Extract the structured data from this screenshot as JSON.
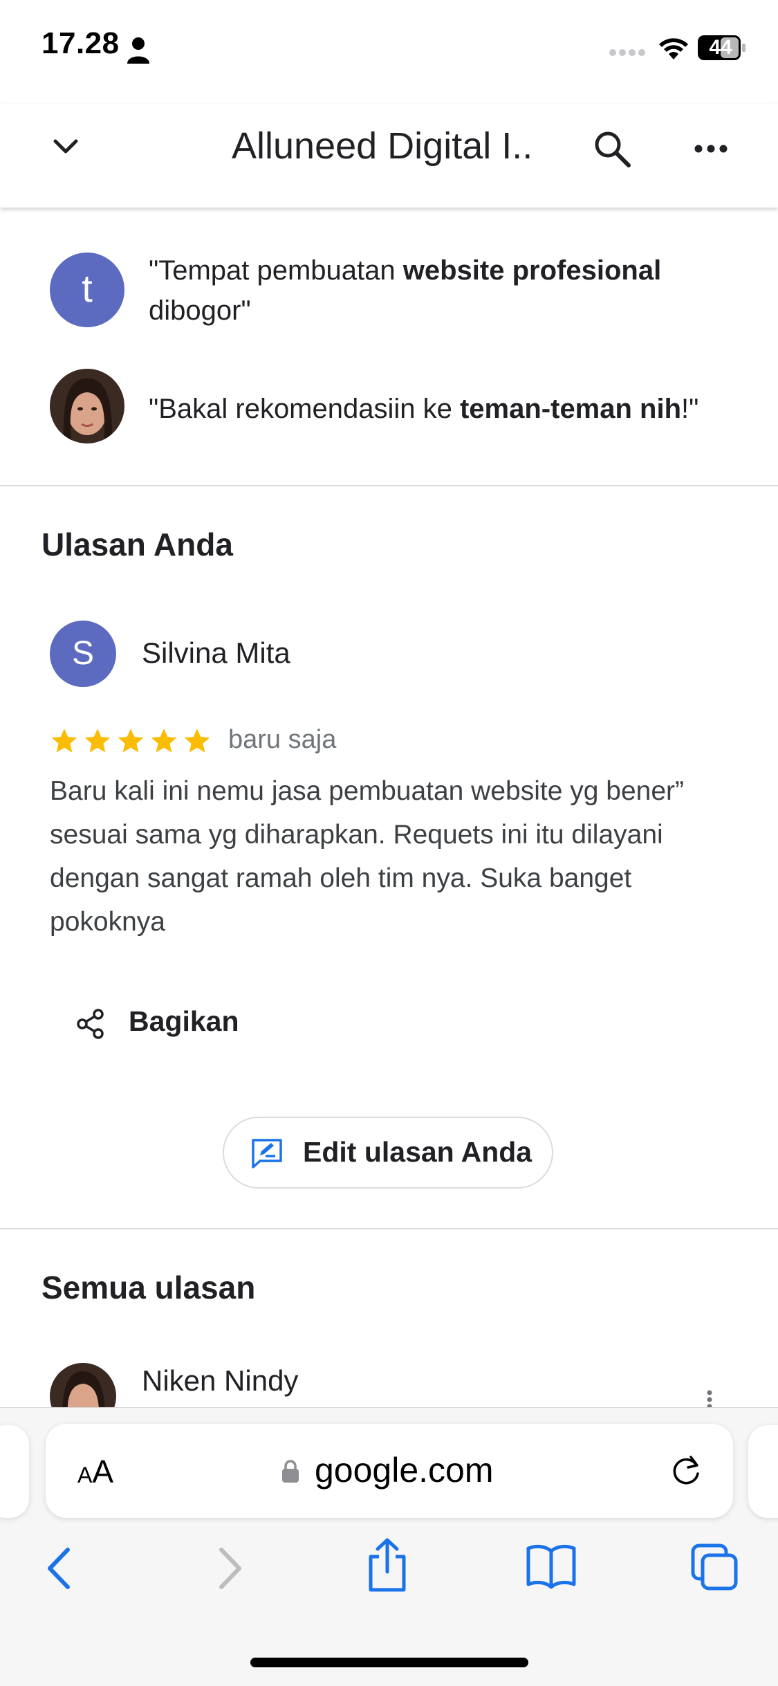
{
  "status_bar": {
    "time": "17.28",
    "battery": "44"
  },
  "header": {
    "title": "Alluneed Digital I..."
  },
  "snippets": [
    {
      "avatar_letter": "t",
      "before": "\"Tempat pembuatan ",
      "bold": "website profesional",
      "after": " dibogor\""
    },
    {
      "before": "\"Bakal rekomendasiin ke ",
      "bold": "teman-teman nih",
      "after": "!\""
    }
  ],
  "your_review": {
    "section_title": "Ulasan Anda",
    "avatar_letter": "S",
    "reviewer": "Silvina Mita",
    "rating": 5,
    "timestamp": "baru saja",
    "text": "Baru kali ini nemu jasa pembuatan website yg bener” sesuai sama yg diharapkan. Requets ini itu dilayani dengan sangat ramah oleh tim nya. Suka banget pokoknya",
    "share_label": "Bagikan",
    "edit_label": "Edit ulasan Anda"
  },
  "all_reviews": {
    "section_title": "Semua ulasan",
    "first_reviewer": "Niken Nindy"
  },
  "browser": {
    "aa_label_small": "A",
    "aa_label_large": "A",
    "url": "google.com"
  },
  "colors": {
    "avatar": "#5c6bc0",
    "star": "#fbbc04",
    "ios_blue": "#1a73e8"
  }
}
